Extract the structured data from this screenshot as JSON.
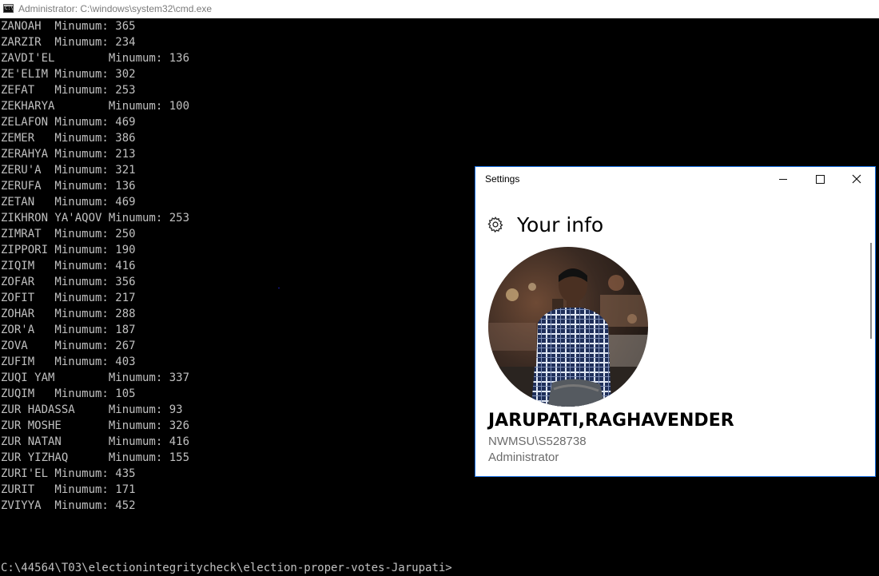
{
  "cmd": {
    "title": "Administrator: C:\\windows\\system32\\cmd.exe",
    "icon": "cmd-console-icon",
    "icon_text": "C:\\",
    "lines": [
      "ZANOAH  Minumum: 365",
      "ZARZIR  Minumum: 234",
      "ZAVDI'EL        Minumum: 136",
      "ZE'ELIM Minumum: 302",
      "ZEFAT   Minumum: 253",
      "ZEKHARYA        Minumum: 100",
      "ZELAFON Minumum: 469",
      "ZEMER   Minumum: 386",
      "ZERAHYA Minumum: 213",
      "ZERU'A  Minumum: 321",
      "ZERUFA  Minumum: 136",
      "ZETAN   Minumum: 469",
      "ZIKHRON YA'AQOV Minumum: 253",
      "ZIMRAT  Minumum: 250",
      "ZIPPORI Minumum: 190",
      "ZIQIM   Minumum: 416",
      "ZOFAR   Minumum: 356",
      "ZOFIT   Minumum: 217",
      "ZOHAR   Minumum: 288",
      "ZOR'A   Minumum: 187",
      "ZOVA    Minumum: 267",
      "ZUFIM   Minumum: 403",
      "ZUQI YAM        Minumum: 337",
      "ZUQIM   Minumum: 105",
      "ZUR HADASSA     Minumum: 93",
      "ZUR MOSHE       Minumum: 326",
      "ZUR NATAN       Minumum: 416",
      "ZUR YIZHAQ      Minumum: 155",
      "ZURI'EL Minumum: 435",
      "ZURIT   Minumum: 171",
      "ZVIYYA  Minumum: 452"
    ],
    "prompt": "C:\\44564\\T03\\electionintegritycheck\\election-proper-votes-Jarupati>",
    "colors": {
      "background": "#000000",
      "text": "#c0c0c0"
    }
  },
  "settings": {
    "window_title": "Settings",
    "page_title": "Your info",
    "icons": {
      "settings": "gear-icon",
      "minimize": "minimize-icon",
      "maximize": "maximize-icon",
      "close": "close-icon"
    },
    "user": {
      "display_name": "JARUPATI,RAGHAVENDER",
      "account": "NWMSU\\S528738",
      "role": "Administrator"
    },
    "colors": {
      "border": "#1a73e8",
      "secondary_text": "#6b6b6b"
    }
  }
}
